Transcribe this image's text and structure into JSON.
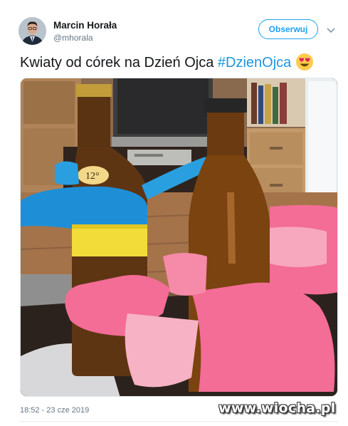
{
  "author": {
    "name": "Marcin Horała",
    "handle": "@mhorala"
  },
  "follow_button": {
    "label": "Obserwuj"
  },
  "tweet": {
    "text": "Kwiaty od córek na Dzień Ojca",
    "hashtag": "#DzienOjca",
    "emoji": "smiling-face-with-heart-eyes-icon"
  },
  "media": {
    "bottle_label": "12°"
  },
  "timestamp": "18:52 - 23 cze 2019",
  "watermark": "www.wiocha.pl",
  "colors": {
    "link": "#1b95e0",
    "follow_border": "#1da1f2",
    "flag_blue": "#1e8fd6",
    "flag_yellow": "#f2dc3a",
    "paper_pink": "#f36d96"
  }
}
